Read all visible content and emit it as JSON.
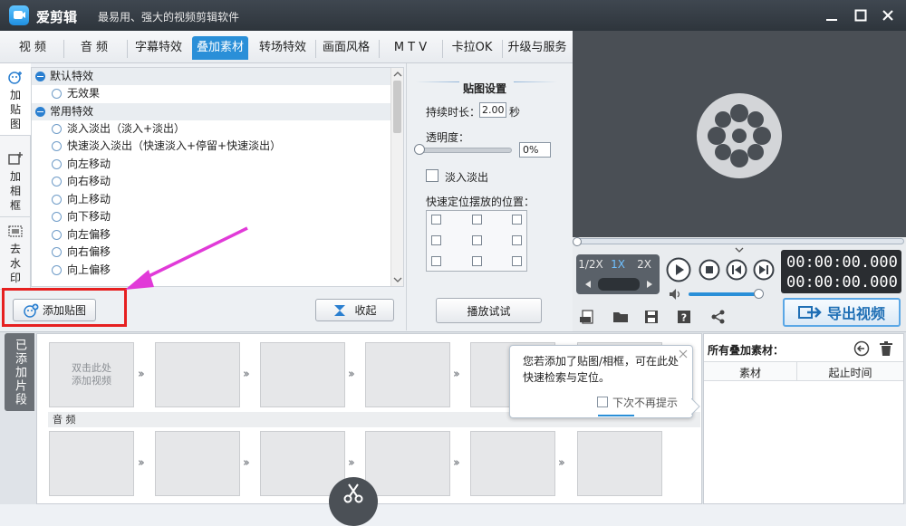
{
  "app": {
    "name": "爱剪辑",
    "slogan": "最易用、强大的视频剪辑软件"
  },
  "tabs": [
    "视 频",
    "音 频",
    "字幕特效",
    "叠加素材",
    "转场特效",
    "画面风格",
    "M T V",
    "卡拉OK",
    "升级与服务"
  ],
  "active_tab": "叠加素材",
  "side_tabs": [
    {
      "label": "加贴图",
      "icon": "sticker-icon"
    },
    {
      "label": "加相框",
      "icon": "frame-icon"
    },
    {
      "label": "去水印",
      "icon": "watermark-icon"
    }
  ],
  "effects": {
    "group_default": "默认特效",
    "default_items": [
      "无效果"
    ],
    "group_common": "常用特效",
    "common_items": [
      "淡入淡出（淡入+淡出）",
      "快速淡入淡出（快速淡入+停留+快速淡出）",
      "向左移动",
      "向右移动",
      "向上移动",
      "向下移动",
      "向左偏移",
      "向右偏移",
      "向上偏移"
    ]
  },
  "footer": {
    "add_sticker": "添加贴图",
    "collapse": "收起"
  },
  "settings": {
    "title": "贴图设置",
    "duration_label": "持续时长：",
    "duration_value": "2.00",
    "duration_unit": "秒",
    "opacity_label": "透明度：",
    "opacity_value": "0%",
    "fade_label": "淡入淡出",
    "position_label": "快速定位摆放的位置：",
    "play_test": "播放试试"
  },
  "player": {
    "speeds": [
      "1/2X",
      "1X",
      "2X"
    ],
    "active_speed": "1X",
    "time_current": "00:00:00.000",
    "time_total": "00:00:00.000",
    "export_label": "导出视频"
  },
  "timeline": {
    "added_tab": "已添加片段",
    "add_video_hint": "双击此处\n添加视频",
    "audio_label": "音 频"
  },
  "tooltip": {
    "text": "您若添加了贴图/相框，可在此处快速检索与定位。",
    "dont_show": "下次不再提示"
  },
  "all_materials": {
    "title": "所有叠加素材：",
    "col_material": "素材",
    "col_time": "起止时间"
  },
  "colors": {
    "accent": "#2a8fd8",
    "highlight_box": "#e62020",
    "arrow": "#e13ad8"
  }
}
